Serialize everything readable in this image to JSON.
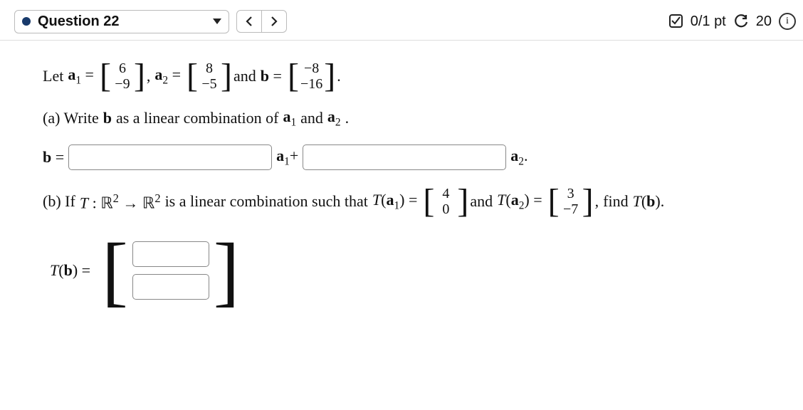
{
  "header": {
    "question_label": "Question 22",
    "score": "0/1 pt",
    "attempts": "20"
  },
  "intro": {
    "let": "Let ",
    "a1_label_b": "a",
    "a1_sub": "1",
    "eq": " = ",
    "a1_top": "6",
    "a1_bot": "−9",
    "comma": ", ",
    "a2_label_b": "a",
    "a2_sub": "2",
    "a2_top": "8",
    "a2_bot": "−5",
    "and": " and ",
    "b_label": "b",
    "b_top": "−8",
    "b_bot": "−16",
    "dot": "."
  },
  "parta": {
    "prompt_pre": "(a) Write",
    "b_label": "b",
    "prompt_mid": "as a linear combination of",
    "a1b": "a",
    "a1s": "1",
    "and": "and",
    "a2b": "a",
    "a2s": "2",
    "dot": ".",
    "line_b": "b",
    "eq": "=",
    "mid": "a",
    "mid_s": "1",
    "plus": "+",
    "end": "a",
    "end_s": "2",
    "enddot": "."
  },
  "partb": {
    "pre": "(b) If ",
    "T": "T",
    "colon": " : ",
    "R": "ℝ",
    "sq": "2",
    "arrow": " → ",
    "txt": " is a linear combination such that ",
    "Ta1_top": "4",
    "Ta1_bot": "0",
    "Ta2_top": "3",
    "Ta2_bot": "−7",
    "and": " and ",
    "comma": ", ",
    "find": " find ",
    "Tb": "T",
    "b": "b",
    "dot": ".",
    "eq": " = "
  },
  "answer2": {
    "Tb_label_T": "T",
    "Tb_label_b": "b",
    "eq": " = "
  }
}
